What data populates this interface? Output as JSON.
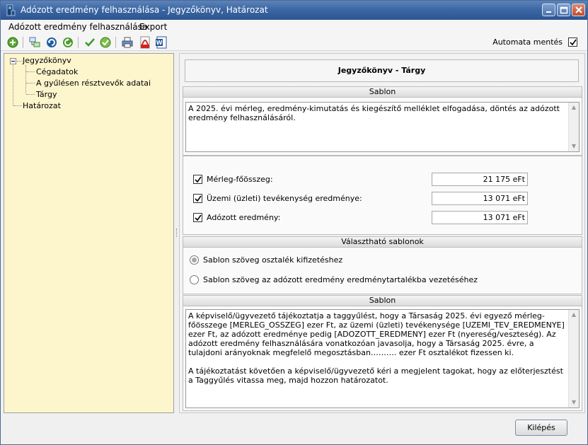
{
  "window": {
    "title": "Adózott eredmény felhasználása - Jegyzőkönyv, Határozat"
  },
  "menu": {
    "items": [
      {
        "label": "Adózott eredmény felhasználása"
      },
      {
        "label": "Export"
      }
    ]
  },
  "toolbar": {
    "autosave_label": "Automata mentés",
    "autosave_checked": true,
    "icons": [
      "add-icon",
      "tree-view-icon",
      "refresh-icon",
      "redo-icon",
      "check-icon",
      "check-all-icon",
      "print-icon",
      "pdf-icon",
      "word-icon"
    ]
  },
  "tree": {
    "root": "Jegyzőkönyv",
    "children": [
      "Cégadatok",
      "A gyűlésen résztvevők adatai",
      "Tárgy"
    ],
    "second": "Határozat"
  },
  "panel": {
    "heading": "Jegyzőkönyv - Tárgy",
    "sablon1": {
      "header": "Sablon",
      "text": "A 2025. évi mérleg, eredmény-kimutatás és kiegészítő melléklet elfogadása, döntés az adózott eredmény felhasználásáról."
    },
    "fields": [
      {
        "label": "Mérleg-főösszeg:",
        "value": "21 175 eFt",
        "checked": true
      },
      {
        "label": "Üzemi (üzleti) tevékenység eredménye:",
        "value": "13 071 eFt",
        "checked": true
      },
      {
        "label": "Adózott eredmény:",
        "value": "13 071 eFt",
        "checked": true
      }
    ],
    "templates": {
      "header": "Választható sablonok",
      "options": [
        {
          "label": "Sablon szöveg osztalék kifizetéshez",
          "selected": true
        },
        {
          "label": "Sablon szöveg az adózott eredmény eredménytartalékba vezetéséhez",
          "selected": false
        }
      ]
    },
    "sablon2": {
      "header": "Sablon",
      "paragraph1": "A  képviselő/ügyvezető tájékoztatja a taggyűlést, hogy a Társaság 2025. évi egyező mérleg-főösszege [MERLEG_OSSZEG] ezer Ft, az üzemi (üzleti) tevékenysége [UZEMI_TEV_EREDMENYE] ezer Ft, az adózott eredménye pedig [ADOZOTT_EREDMENY] ezer Ft (nyereség/veszteség). Az adózott eredmény felhasználására vonatkozóan javasolja, hogy a Társaság 2025. évre, a tulajdoni arányoknak megfelelő megosztásban………. ezer Ft osztalékot fizessen ki.",
      "paragraph2": "A tájékoztatást követően a képviselő/ügyvezető kéri a megjelent tagokat, hogy az előterjesztést a Taggyűlés vitassa meg, majd hozzon határozatot."
    }
  },
  "footer": {
    "exit_label": "Kilépés"
  },
  "colors": {
    "titlebar": "#3c67a5",
    "tree_bg": "#fdf5cc"
  }
}
